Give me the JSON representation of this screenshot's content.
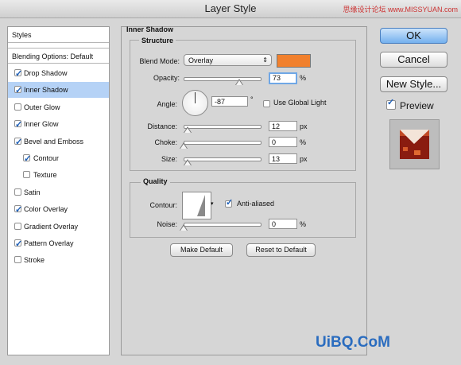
{
  "window": {
    "title": "Layer Style",
    "watermark_top": "思缘设计论坛 www.MISSYUAN.com"
  },
  "sidebar": {
    "header": "Styles",
    "blending": "Blending Options: Default",
    "items": [
      {
        "label": "Drop Shadow",
        "checked": true,
        "selected": false,
        "indent": false
      },
      {
        "label": "Inner Shadow",
        "checked": true,
        "selected": true,
        "indent": false
      },
      {
        "label": "Outer Glow",
        "checked": false,
        "selected": false,
        "indent": false
      },
      {
        "label": "Inner Glow",
        "checked": true,
        "selected": false,
        "indent": false
      },
      {
        "label": "Bevel and Emboss",
        "checked": true,
        "selected": false,
        "indent": false
      },
      {
        "label": "Contour",
        "checked": true,
        "selected": false,
        "indent": true
      },
      {
        "label": "Texture",
        "checked": false,
        "selected": false,
        "indent": true
      },
      {
        "label": "Satin",
        "checked": false,
        "selected": false,
        "indent": false
      },
      {
        "label": "Color Overlay",
        "checked": true,
        "selected": false,
        "indent": false
      },
      {
        "label": "Gradient Overlay",
        "checked": false,
        "selected": false,
        "indent": false
      },
      {
        "label": "Pattern Overlay",
        "checked": true,
        "selected": false,
        "indent": false
      },
      {
        "label": "Stroke",
        "checked": false,
        "selected": false,
        "indent": false
      }
    ]
  },
  "inner_shadow": {
    "title": "Inner Shadow",
    "structure": {
      "title": "Structure",
      "blend_mode_label": "Blend Mode:",
      "blend_mode_value": "Overlay",
      "color": "#f1802d",
      "opacity_label": "Opacity:",
      "opacity_value": "73",
      "opacity_unit": "%",
      "opacity_fraction": 0.73,
      "angle_label": "Angle:",
      "angle_value": "-87",
      "angle_unit": "°",
      "global_light_label": "Use Global Light",
      "global_light_checked": false,
      "distance_label": "Distance:",
      "distance_value": "12",
      "distance_unit": "px",
      "distance_fraction": 0.05,
      "choke_label": "Choke:",
      "choke_value": "0",
      "choke_unit": "%",
      "choke_fraction": 0,
      "size_label": "Size:",
      "size_value": "13",
      "size_unit": "px",
      "size_fraction": 0.05
    },
    "quality": {
      "title": "Quality",
      "contour_label": "Contour:",
      "antialias_label": "Anti-aliased",
      "antialias_checked": true,
      "noise_label": "Noise:",
      "noise_value": "0",
      "noise_unit": "%",
      "noise_fraction": 0
    },
    "make_default": "Make Default",
    "reset_default": "Reset to Default"
  },
  "actions": {
    "ok": "OK",
    "cancel": "Cancel",
    "new_style": "New Style...",
    "preview_label": "Preview",
    "preview_checked": true
  },
  "watermark_bottom": "UiBQ.CoM"
}
